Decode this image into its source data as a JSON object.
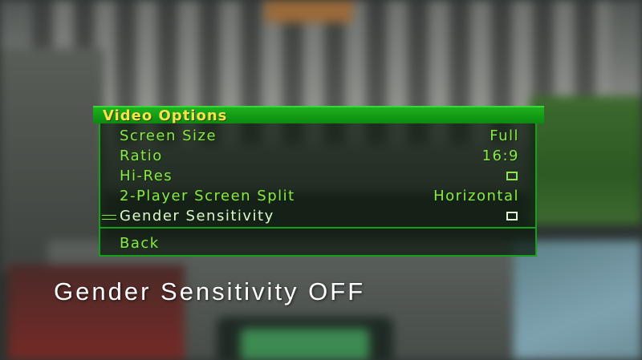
{
  "menu": {
    "title": "Video Options",
    "items": [
      {
        "label": "Screen Size",
        "value": "Full"
      },
      {
        "label": "Ratio",
        "value": "16:9"
      },
      {
        "label": "Hi-Res",
        "checked": false
      },
      {
        "label": "2-Player Screen Split",
        "value": "Horizontal"
      },
      {
        "label": "Gender Sensitivity",
        "checked": false,
        "selected": true
      }
    ],
    "back_label": "Back"
  },
  "caption": "Gender Sensitivity OFF",
  "colors": {
    "header_green": "#1eb11e",
    "title_yellow": "#f0e64a",
    "item_green": "#8ce848",
    "selected_text": "#e0f5d2"
  },
  "icons": {
    "cursor": "menu-cursor-icon",
    "checkbox": "empty-checkbox-icon"
  }
}
